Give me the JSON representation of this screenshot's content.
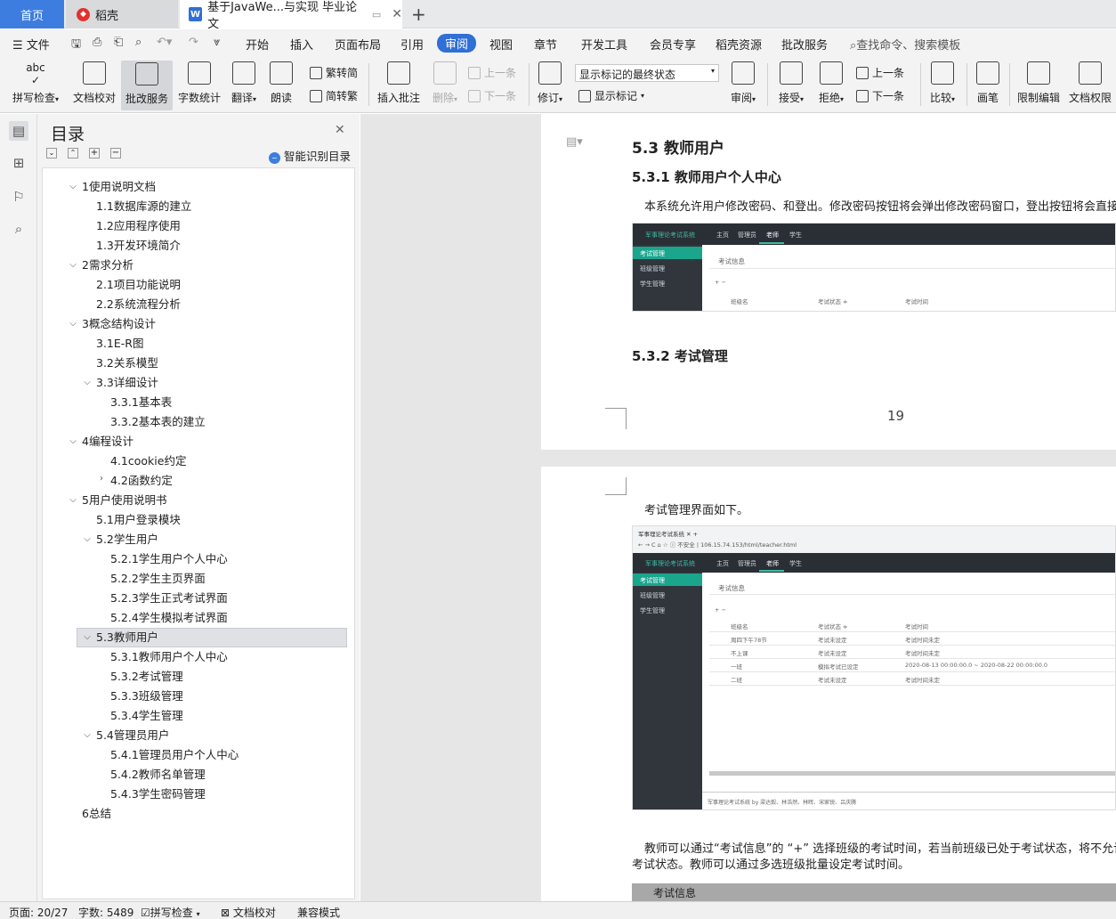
{
  "tabs": {
    "home": "首页",
    "daoke": "稻壳",
    "doc": "基于JavaWe...与实现 毕业论文"
  },
  "menu": {
    "file": "文件",
    "items": [
      "开始",
      "插入",
      "页面布局",
      "引用",
      "审阅",
      "视图",
      "章节",
      "开发工具",
      "会员专享",
      "稻壳资源",
      "批改服务"
    ],
    "search": "查找命令、搜索模板"
  },
  "ribbon": {
    "spell": "拼写检查",
    "proof": "文档校对",
    "grading": "批改服务",
    "wordcount": "字数统计",
    "translate": "翻译",
    "read": "朗读",
    "trad": "繁转简",
    "simp": "简转繁",
    "insert_comment": "插入批注",
    "delete": "删除",
    "prev": "上一条",
    "next": "下一条",
    "revise": "修订",
    "markup_select": "显示标记的最终状态",
    "show_markup": "显示标记",
    "review": "审阅",
    "accept": "接受",
    "reject": "拒绝",
    "prev2": "上一条",
    "next2": "下一条",
    "compare": "比较",
    "pen": "画笔",
    "restrict": "限制编辑",
    "perm": "文档权限"
  },
  "toc": {
    "title": "目录",
    "smart": "智能识别目录",
    "items": [
      "1使用说明文档",
      "1.1数据库源的建立",
      "1.2应用程序使用",
      "1.3开发环境简介",
      "2需求分析",
      "2.1项目功能说明",
      "2.2系统流程分析",
      "3概念结构设计",
      "3.1E-R图",
      "3.2关系模型",
      "3.3详细设计",
      "3.3.1基本表",
      "3.3.2基本表的建立",
      "4编程设计",
      "4.1cookie约定",
      "4.2函数约定",
      "5用户使用说明书",
      "5.1用户登录模块",
      "5.2学生用户",
      "5.2.1学生用户个人中心",
      "5.2.2学生主页界面",
      "5.2.3学生正式考试界面",
      "5.2.4学生模拟考试界面",
      "5.3教师用户",
      "5.3.1教师用户个人中心",
      "5.3.2考试管理",
      "5.3.3班级管理",
      "5.3.4学生管理",
      "5.4管理员用户",
      "5.4.1管理员用户个人中心",
      "5.4.2教师名单管理",
      "5.4.3学生密码管理",
      "6总结"
    ]
  },
  "doc": {
    "h53": "5.3 教师用户",
    "h531": "5.3.1 教师用户个人中心",
    "p1": "本系统允许用户修改密码、和登出。修改密码按钮将会弹出修改密码窗口，登出按钮将会直接登",
    "h532": "5.3.2 考试管理",
    "page_num": "19",
    "p2": "考试管理界面如下。",
    "p3a": "教师可以通过“考试信息”的 “+” 选择班级的考试时间，若当前班级已处于考试状态，将不允许教",
    "p3b": "考试状态。教师可以通过多选班级批量设定考试时间。",
    "caption": "考试信息"
  },
  "shot": {
    "app": "军事理论考试系统",
    "nav": [
      "主页",
      "管理员",
      "老师",
      "学生"
    ],
    "side": [
      "考试管理",
      "班级管理",
      "学生管理"
    ],
    "panel": "考试信息",
    "cols": [
      "班级名",
      "考试状态 ≑",
      "考试时间"
    ],
    "rows": [
      [
        "周四下午78节",
        "考试未设定",
        "考试时间未定"
      ],
      [
        "不上课",
        "考试未设定",
        "考试时间未定"
      ],
      [
        "一班",
        "模拟考试已设定",
        "2020-08-13 00:00:00.0 ~ 2020-08-22 00:00:00.0"
      ],
      [
        "二班",
        "考试未设定",
        "考试时间未定"
      ]
    ],
    "browser_tab": "军事理论考试系统",
    "url": "不安全 | 106.15.74.153/html/teacher.html",
    "footer": "军事理论考试系统 by 梁达毅、林浩然、林晖、宋家锐、吕庆腾"
  },
  "status": {
    "page": "页面: 20/27",
    "words": "字数: 5489",
    "spell": "拼写检查",
    "proof": "文档校对",
    "compat": "兼容模式"
  }
}
